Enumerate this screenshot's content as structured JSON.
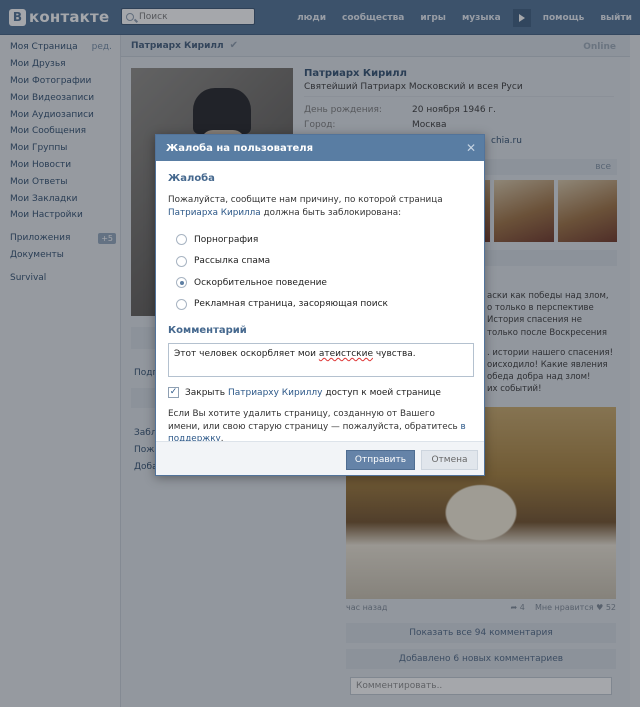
{
  "header": {
    "logo": "контакте",
    "logo_letter": "В",
    "search_placeholder": "Поиск",
    "nav": [
      "люди",
      "сообщества",
      "игры",
      "музыка",
      "помощь",
      "выйти"
    ]
  },
  "sidebar": {
    "items": [
      {
        "label": "Моя Страница",
        "extra": "ред."
      },
      {
        "label": "Мои Друзья"
      },
      {
        "label": "Мои Фотографии"
      },
      {
        "label": "Мои Видеозаписи"
      },
      {
        "label": "Мои Аудиозаписи"
      },
      {
        "label": "Мои Сообщения"
      },
      {
        "label": "Мои Группы"
      },
      {
        "label": "Мои Новости"
      },
      {
        "label": "Мои Ответы"
      },
      {
        "label": "Мои Закладки"
      },
      {
        "label": "Мои Настройки"
      }
    ],
    "apps_label": "Приложения",
    "apps_badge": "+5",
    "documents_label": "Документы",
    "survival_label": "Survival"
  },
  "profile": {
    "header_name": "Патриарх Кирилл",
    "online": "Online",
    "name": "Патриарх Кирилл",
    "status": "Святейший Патриарх Московский и всея Руси",
    "birthday_label": "День рождения:",
    "birthday": "20 ноября 1946 г.",
    "city_label": "Город:",
    "city": "Москва",
    "site_fragment": "chia.ru",
    "photos_all": "все",
    "left_partial": [
      "Подп",
      "Забл",
      "Пожа",
      "Доба"
    ]
  },
  "wall": {
    "text_lines": [
      "аски как победы над злом,",
      "о только в перспективе",
      "История спасения не",
      "только после Воскресения",
      ". истории нашего спасения!",
      "оисходило! Какие явления",
      "обеда добра над злом!",
      "их событий!"
    ],
    "time": "час назад",
    "reposts": "4",
    "likes_label": "Мне нравится",
    "likes": "52",
    "show_all_comments": "Показать все 94 комментария",
    "new_comments": "Добавлено 6 новых комментариев",
    "comment_placeholder": "Комментировать.."
  },
  "dialog": {
    "title": "Жалоба на пользователя",
    "close": "✕",
    "complaint_heading": "Жалоба",
    "desc_before": "Пожалуйста, сообщите нам причину, по которой страница ",
    "desc_link": "Патриарха Кирилла",
    "desc_after": " должна быть заблокирована:",
    "options": [
      {
        "label": "Порнография",
        "selected": false
      },
      {
        "label": "Рассылка спама",
        "selected": false
      },
      {
        "label": "Оскорбительное поведение",
        "selected": true
      },
      {
        "label": "Рекламная страница, засоряющая поиск",
        "selected": false
      }
    ],
    "comment_heading": "Комментарий",
    "comment_before": "Этот человек оскорбляет мои ",
    "comment_misspelled": "атеистские",
    "comment_after": " чувства.",
    "checkbox_before": "Закрыть ",
    "checkbox_link": "Патриарху Кириллу",
    "checkbox_after": " доступ к моей странице",
    "checkbox_checked": true,
    "note_text": "Если Вы хотите удалить страницу, созданную от Вашего имени, или свою старую страницу — пожалуйста, обратитесь ",
    "note_link": "в поддержку",
    "note_end": ".",
    "send": "Отправить",
    "cancel": "Отмена"
  }
}
